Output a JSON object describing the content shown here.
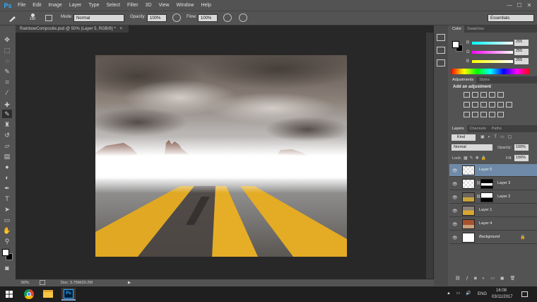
{
  "menubar": {
    "logo": "Ps",
    "items": [
      "File",
      "Edit",
      "Image",
      "Layer",
      "Type",
      "Select",
      "Filter",
      "3D",
      "View",
      "Window",
      "Help"
    ],
    "minimize": "—",
    "maximize": "☐",
    "close": "✕"
  },
  "options": {
    "brush_size": "150",
    "mode_label": "Mode:",
    "mode_value": "Normal",
    "opacity_label": "Opacity:",
    "opacity_value": "100%",
    "flow_label": "Flow:",
    "flow_value": "100%",
    "workspace": "Essentials"
  },
  "document": {
    "tab_title": "RainbowComposite.psd @ 50% (Layer 5, RGB/8) *",
    "tab_close": "×"
  },
  "status": {
    "zoom": "50%",
    "doc_info": "Doc: 3.75M/20.2M"
  },
  "color_panel": {
    "tabs": [
      "Color",
      "Swatches"
    ],
    "channels": [
      {
        "label": "R",
        "value": "255"
      },
      {
        "label": "G",
        "value": "255"
      },
      {
        "label": "B",
        "value": "255"
      }
    ]
  },
  "adjustments_panel": {
    "tabs": [
      "Adjustments",
      "Styles"
    ],
    "title": "Add an adjustment"
  },
  "layers_panel": {
    "tabs": [
      "Layers",
      "Channels",
      "Paths"
    ],
    "kind_label": "Kind",
    "blend_mode": "Normal",
    "opacity_label": "Opacity:",
    "opacity_value": "100%",
    "lock_label": "Lock:",
    "fill_label": "Fill:",
    "fill_value": "100%",
    "layers": [
      {
        "name": "Layer 5",
        "selected": true
      },
      {
        "name": "Layer 3",
        "selected": false
      },
      {
        "name": "Layer 2",
        "selected": false
      },
      {
        "name": "Layer 1",
        "selected": false
      },
      {
        "name": "Layer 4",
        "selected": false
      },
      {
        "name": "Background",
        "selected": false
      }
    ]
  },
  "taskbar": {
    "language": "ENG",
    "time": "16:08",
    "date": "03/11/2017"
  },
  "colors": {
    "ui_bg": "#535353",
    "doc_bg": "#282828",
    "selected_layer": "#6f8aa8",
    "ps_blue": "#31a8ff"
  }
}
